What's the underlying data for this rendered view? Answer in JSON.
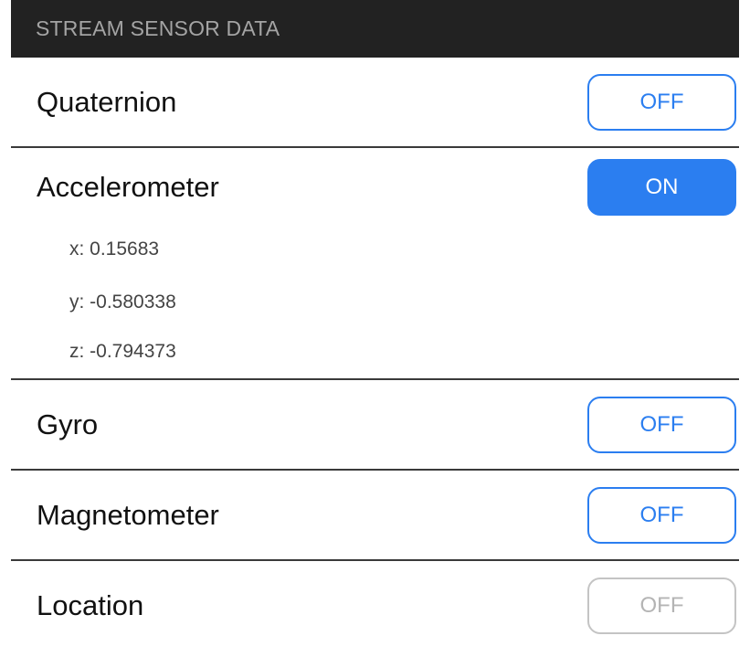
{
  "section": {
    "title": "STREAM SENSOR DATA"
  },
  "sensors": [
    {
      "label": "Quaternion",
      "toggle": "OFF",
      "state": "off"
    },
    {
      "label": "Accelerometer",
      "toggle": "ON",
      "state": "on",
      "readings": [
        "x: 0.15683",
        "y: -0.580338",
        "z: -0.794373"
      ]
    },
    {
      "label": "Gyro",
      "toggle": "OFF",
      "state": "off"
    },
    {
      "label": "Magnetometer",
      "toggle": "OFF",
      "state": "off"
    },
    {
      "label": "Location",
      "toggle": "OFF",
      "state": "disabled"
    }
  ],
  "colors": {
    "accent": "#2b7ef0",
    "header_bg": "#222222",
    "header_text": "#a4a4a4",
    "disabled": "#b4b4b4"
  }
}
